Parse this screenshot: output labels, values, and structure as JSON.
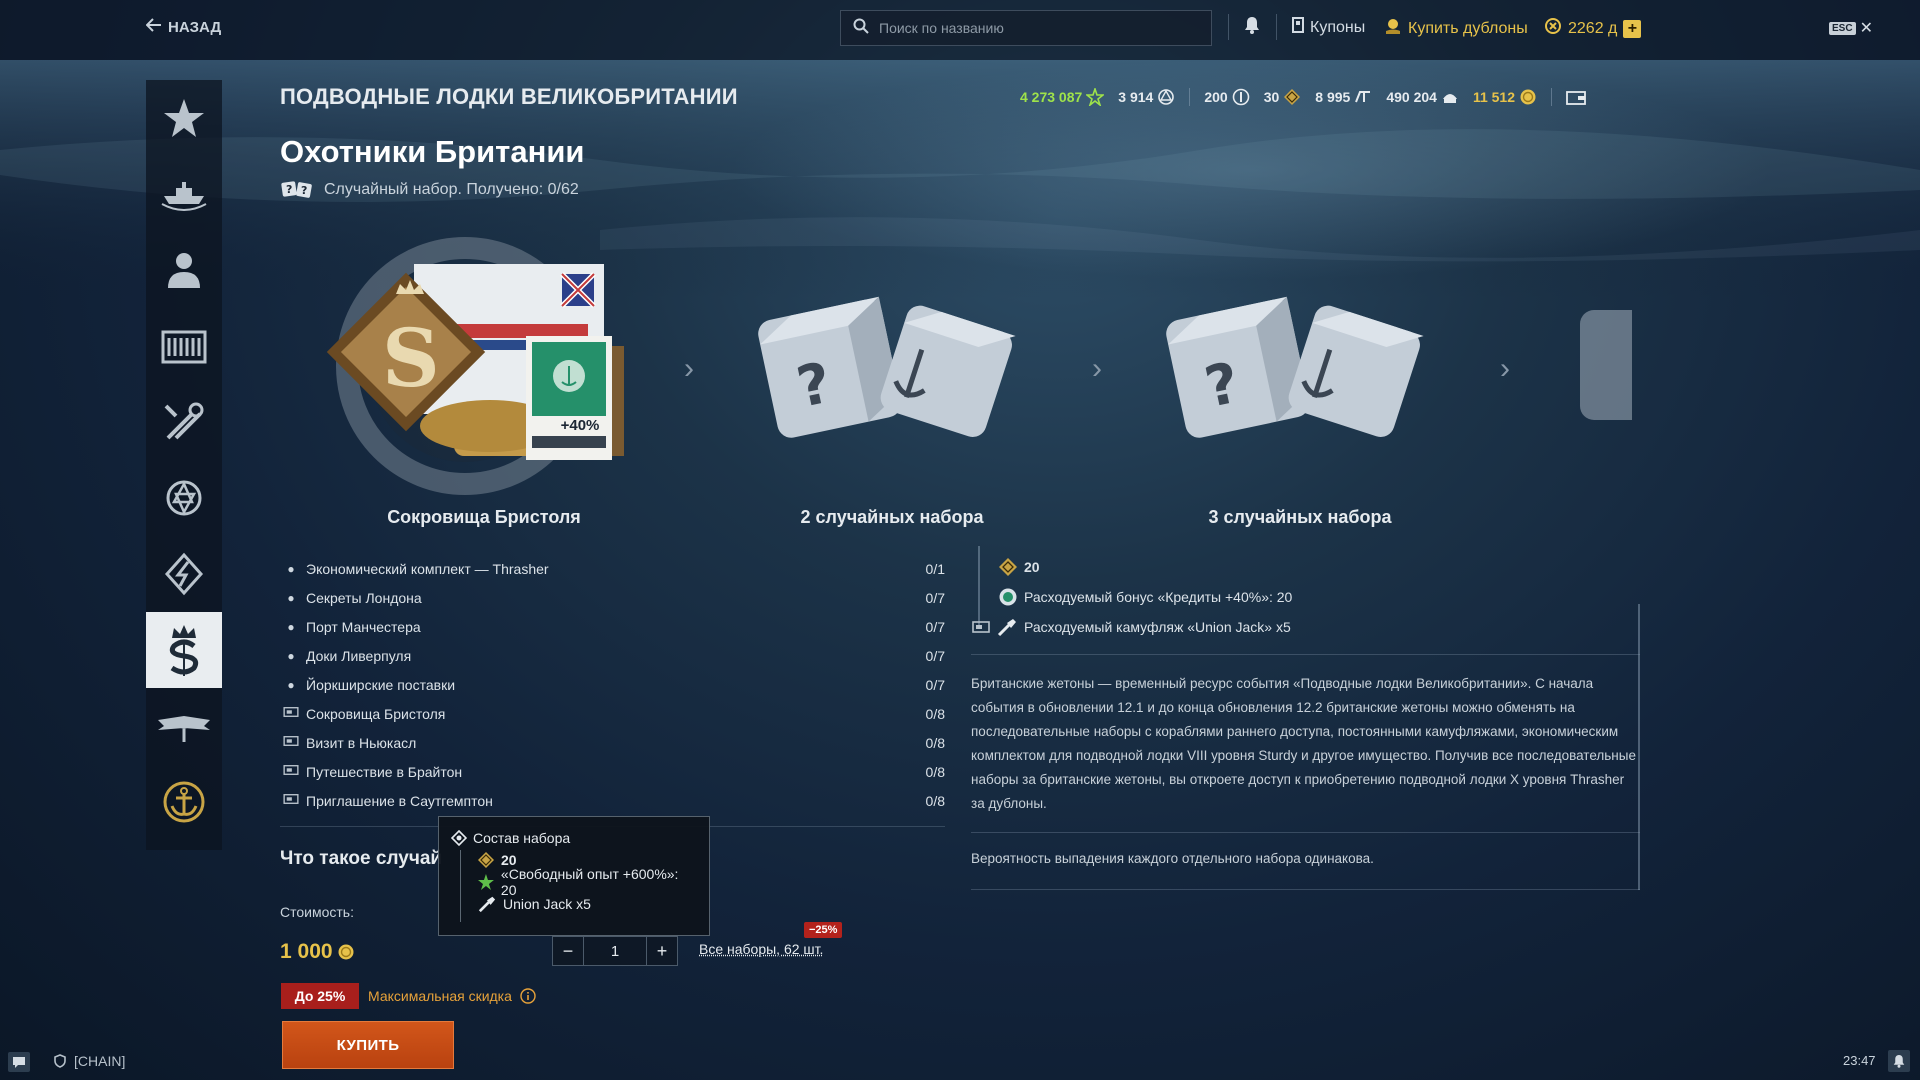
{
  "topbar": {
    "back_label": "НАЗАД",
    "search_placeholder": "Поиск по названию",
    "coupons_label": "Купоны",
    "buy_doubloons_label": "Купить дублоны",
    "doubloons_value": "2262 д",
    "esc_label": "ESC"
  },
  "header": {
    "page_title": "ПОДВОДНЫЕ ЛОДКИ ВЕЛИКОБРИТАНИИ",
    "resources": {
      "free_xp": "4 273 087",
      "elite_xp": "3 914",
      "tokens": "200",
      "brit_tokens": "30",
      "coal": "8 995",
      "steel": "490 204",
      "credits": "11 512"
    }
  },
  "bundle": {
    "title": "Охотники Британии",
    "subtitle": "Случайный набор. Получено: 0/62"
  },
  "carousel": {
    "item1_label": "Сокровища Бристоля",
    "item1_badge": "+40%",
    "item2_label": "2 случайных набора",
    "item3_label": "3 случайных набора"
  },
  "list": {
    "rows": [
      {
        "name": "Экономический комплект — Thrasher",
        "count": "0/1",
        "marker": "bullet"
      },
      {
        "name": "Секреты Лондона",
        "count": "0/7",
        "marker": "bullet"
      },
      {
        "name": "Порт Манчестера",
        "count": "0/7",
        "marker": "bullet"
      },
      {
        "name": "Доки Ливерпуля",
        "count": "0/7",
        "marker": "bullet"
      },
      {
        "name": "Йоркширские поставки",
        "count": "0/7",
        "marker": "bullet"
      },
      {
        "name": "Сокровища Бристоля",
        "count": "0/8",
        "marker": "camo"
      },
      {
        "name": "Визит в Ньюкасл",
        "count": "0/8",
        "marker": "camo"
      },
      {
        "name": "Путешествие в Брайтон",
        "count": "0/8",
        "marker": "camo"
      },
      {
        "name": "Приглашение в Саутгемптон",
        "count": "0/8",
        "marker": "camo"
      }
    ]
  },
  "right": {
    "tokens_amount": "20",
    "bonus_line": "Расходуемый бонус «Кредиты +40%»: 20",
    "camo_line": "Расходуемый камуфляж «Union Jack» х5",
    "description": "Британские жетоны — временный ресурс события «Подводные лодки Великобритании». С начала события в обновлении 12.1 и до конца обновления 12.2 британские жетоны можно обменять на последовательные наборы с кораблями раннего доступа, постоянными камуфляжами, экономическим комплектом для подводной лодки VIII уровня Sturdy и другое имущество. Получив все последовательные наборы за британские жетоны, вы откроете доступ к приобретению подводной лодки X уровня Thrasher за дублоны.",
    "probability": "Вероятность выпадения каждого отдельного набора одинакова."
  },
  "purchase": {
    "what_is": "Что такое случай",
    "what_is_tail": "р",
    "cost_label": "Стоимость:",
    "price": "1 000",
    "quantity": "1",
    "all_sets": "Все наборы, 62 шт.",
    "discount_badge": "−25%",
    "upto_label": "До 25%",
    "max_discount": "Максимальная скидка",
    "buy_label": "КУПИТЬ"
  },
  "tooltip": {
    "title": "Состав набора",
    "tokens": "20",
    "free_xp_bonus": "«Свободный опыт +600%»: 20",
    "camo": "Union Jack х5"
  },
  "status": {
    "clan": "[CHAIN]",
    "time": "23:47"
  },
  "colors": {
    "gold": "#e7c24a",
    "green": "#9fe34a",
    "buy_orange": "#c94c14",
    "discount_red": "#a81f1c"
  }
}
